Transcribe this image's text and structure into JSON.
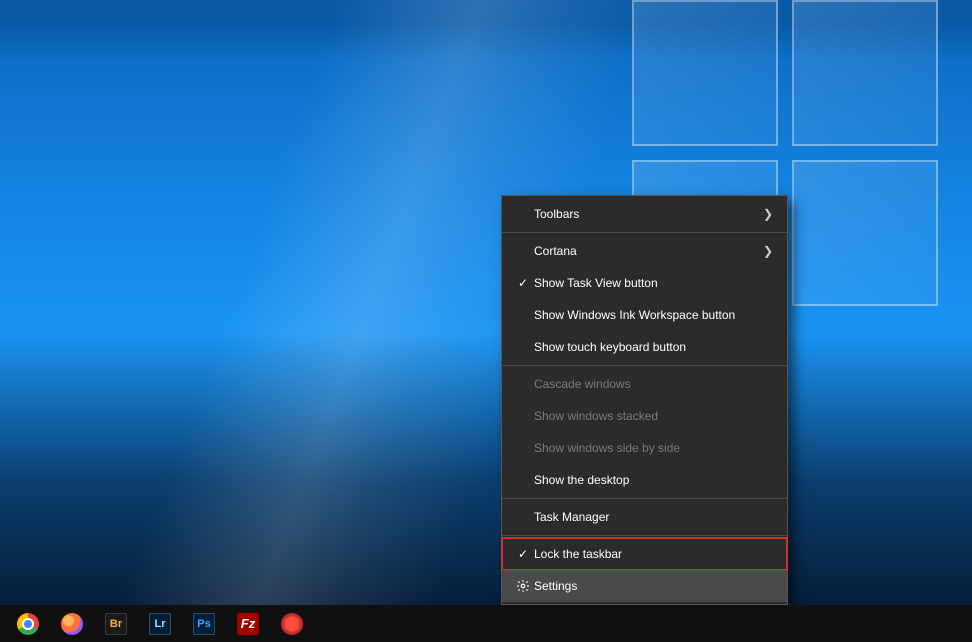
{
  "context_menu": {
    "items": [
      {
        "label": "Toolbars",
        "submenu": true
      },
      {
        "sep": true
      },
      {
        "label": "Cortana",
        "submenu": true
      },
      {
        "label": "Show Task View button",
        "checked": true
      },
      {
        "label": "Show Windows Ink Workspace button"
      },
      {
        "label": "Show touch keyboard button"
      },
      {
        "sep": true
      },
      {
        "label": "Cascade windows",
        "disabled": true
      },
      {
        "label": "Show windows stacked",
        "disabled": true
      },
      {
        "label": "Show windows side by side",
        "disabled": true
      },
      {
        "label": "Show the desktop"
      },
      {
        "sep": true
      },
      {
        "label": "Task Manager"
      },
      {
        "sep": true
      },
      {
        "label": "Lock the taskbar",
        "checked": true,
        "highlighted": true
      },
      {
        "label": "Settings",
        "icon": "gear",
        "hover": true
      }
    ]
  },
  "taskbar": {
    "apps": [
      {
        "name": "chrome",
        "glyph": ""
      },
      {
        "name": "firefox",
        "glyph": ""
      },
      {
        "name": "bridge",
        "glyph": "Br"
      },
      {
        "name": "lightroom",
        "glyph": "Lr"
      },
      {
        "name": "photoshop",
        "glyph": "Ps"
      },
      {
        "name": "filezilla",
        "glyph": "Fz"
      },
      {
        "name": "creative-cloud",
        "glyph": ""
      }
    ]
  }
}
